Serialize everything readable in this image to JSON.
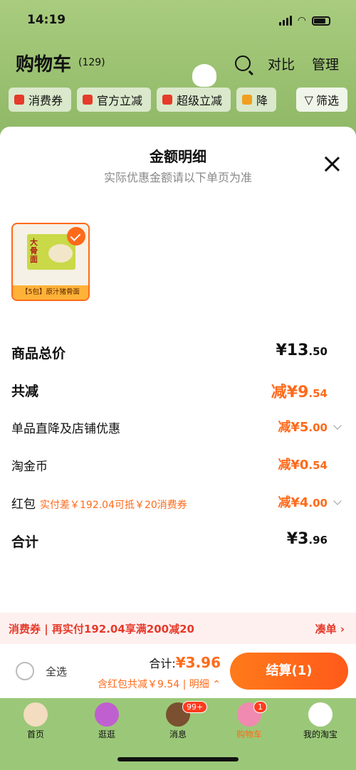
{
  "status": {
    "time": "14:19"
  },
  "header": {
    "title": "购物车",
    "count": "(129)",
    "compare": "对比",
    "manage": "管理"
  },
  "filters": {
    "chips": [
      {
        "label": "消费券",
        "color": "#e63a2a"
      },
      {
        "label": "官方立减",
        "color": "#e63a2a"
      },
      {
        "label": "超级立减",
        "color": "#e63a2a"
      },
      {
        "label": "降",
        "color": "#f0a020"
      }
    ],
    "filter_label": "筛选"
  },
  "sheet": {
    "title": "金额明细",
    "subtitle": "实际优惠金额请以下单页为准",
    "product_label": "【5包】原汁猪骨面",
    "product_pkg_text": "大骨面",
    "rows": [
      {
        "label": "商品总价",
        "value": "¥13",
        "decimal": ".50"
      },
      {
        "label": "共减",
        "value": "减¥9",
        "decimal": ".54"
      },
      {
        "label": "单品直降及店铺优惠",
        "value": "减¥5",
        "decimal": ".00"
      },
      {
        "label": "淘金币",
        "value": "减¥0",
        "decimal": ".54"
      },
      {
        "label": "红包",
        "note": "实付差￥192.04可抵￥20消费券",
        "value": "减¥4",
        "decimal": ".00"
      },
      {
        "label": "合计",
        "value": "¥3",
        "decimal": ".96"
      }
    ]
  },
  "promo": {
    "text": "消费券 | 再实付192.04享满200减20",
    "action": "凑单 ›"
  },
  "checkout": {
    "select_all": "全选",
    "total_label": "合计:",
    "total_value": "¥3.96",
    "saved": "含红包共减￥9.54 | 明细 ⌃",
    "pay_button": "结算(1)"
  },
  "tabs": [
    {
      "label": "首页"
    },
    {
      "label": "逛逛"
    },
    {
      "label": "消息",
      "badge": "99+"
    },
    {
      "label": "购物车",
      "badge": "1"
    },
    {
      "label": "我的淘宝"
    }
  ]
}
